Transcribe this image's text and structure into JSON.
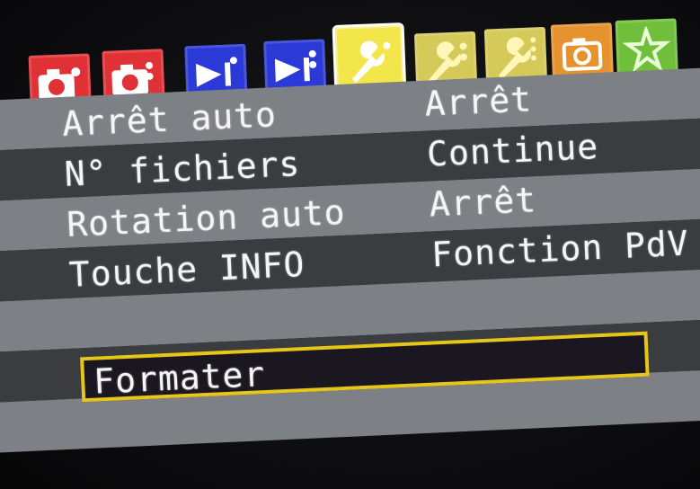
{
  "colors": {
    "tab_red": "#e03236",
    "tab_blue": "#2b39d6",
    "tab_yellow_active": "#f2e64a",
    "tab_yellow": "#d5c95a",
    "tab_orange": "#e6932f",
    "tab_green": "#6fbf3b",
    "selection": "#e6c619",
    "row_light": "#7d8084",
    "row_dark": "#3a3c40"
  },
  "tabs": [
    {
      "icon": "camera-shooting-1-icon",
      "color": "#e03236"
    },
    {
      "icon": "camera-shooting-2-icon",
      "color": "#e03236"
    },
    {
      "icon": "playback-1-icon",
      "color": "#2b39d6"
    },
    {
      "icon": "playback-2-icon",
      "color": "#2b39d6"
    },
    {
      "icon": "setup-1-icon",
      "color": "#f2e64a",
      "active": true
    },
    {
      "icon": "setup-2-icon",
      "color": "#d5c95a"
    },
    {
      "icon": "setup-3-icon",
      "color": "#d5c95a"
    },
    {
      "icon": "custom-functions-icon",
      "color": "#e6932f"
    },
    {
      "icon": "my-menu-icon",
      "color": "#6fbf3b"
    }
  ],
  "menu": {
    "items": [
      {
        "label": "Arrêt auto",
        "value": "Arrêt"
      },
      {
        "label": "N° fichiers",
        "value": "Continue"
      },
      {
        "label": "Rotation auto",
        "value": "Arrêt"
      },
      {
        "label": "Touche INFO",
        "value": "Fonction PdV"
      },
      {
        "label": "Formater",
        "value": ""
      }
    ],
    "selected_index": 4
  }
}
